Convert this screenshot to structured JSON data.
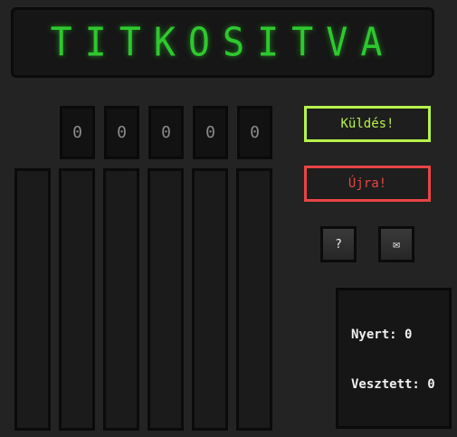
{
  "display": {
    "text": "TITKOSITVA"
  },
  "digits": [
    "0",
    "0",
    "0",
    "0",
    "0"
  ],
  "buttons": {
    "send_label": "Küldés!",
    "reset_label": "Újra!",
    "help_label": "?",
    "mail_label": "✉"
  },
  "score": {
    "won_label": "Nyert:",
    "won_value": "0",
    "lost_label": "Vesztett:",
    "lost_value": "0"
  },
  "colors": {
    "display_green": "#2ec82e",
    "send_border": "#b6f24a",
    "reset_border": "#e84545"
  }
}
